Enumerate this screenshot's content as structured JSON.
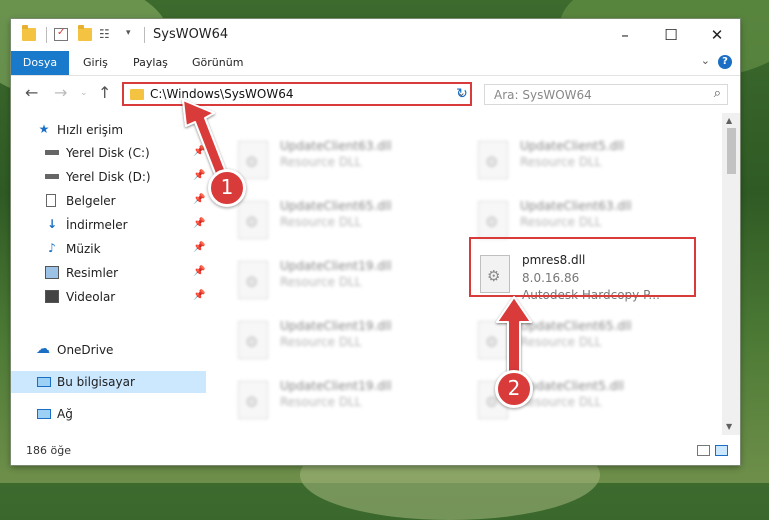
{
  "window": {
    "title": "SysWOW64"
  },
  "ribbon": {
    "tabs": [
      "Dosya",
      "Giriş",
      "Paylaş",
      "Görünüm"
    ]
  },
  "address": {
    "path": "C:\\Windows\\SysWOW64",
    "search_placeholder": "Ara: SysWOW64"
  },
  "sidebar": {
    "items": [
      {
        "label": "Hızlı erişim",
        "icon": "star-icon"
      },
      {
        "label": "Yerel Disk (C:)",
        "icon": "drive-icon"
      },
      {
        "label": "Yerel Disk (D:)",
        "icon": "drive-icon"
      },
      {
        "label": "Belgeler",
        "icon": "document-icon"
      },
      {
        "label": "İndirmeler",
        "icon": "download-icon"
      },
      {
        "label": "Müzik",
        "icon": "music-icon"
      },
      {
        "label": "Resimler",
        "icon": "picture-icon"
      },
      {
        "label": "Videolar",
        "icon": "video-icon"
      },
      {
        "label": "OneDrive",
        "icon": "cloud-icon"
      },
      {
        "label": "Bu bilgisayar",
        "icon": "computer-icon"
      },
      {
        "label": "Ağ",
        "icon": "network-icon"
      }
    ]
  },
  "files": {
    "r1c1": {
      "name": "UpdateClient63.dll",
      "desc": "Resource DLL"
    },
    "r1c2": {
      "name": "UpdateClient5.dll",
      "desc": "Resource DLL"
    },
    "r2c1": {
      "name": "UpdateClient65.dll",
      "desc": "Resource DLL"
    },
    "r2c2": {
      "name": "UpdateClient63.dll",
      "desc": "Resource DLL"
    },
    "r3c1": {
      "name": "UpdateClient19.dll",
      "desc": "Resource DLL"
    },
    "r4c1": {
      "name": "UpdateClient19.dll",
      "desc": "Resource DLL"
    },
    "r4c2": {
      "name": "UpdateClient65.dll",
      "desc": "Resource DLL"
    },
    "r5c1": {
      "name": "UpdateClient19.dll",
      "desc": "Resource DLL"
    },
    "r5c2": {
      "name": "UpdateClient5.dll",
      "desc": "Resource DLL"
    },
    "target": {
      "name": "pmres8.dll",
      "version": "8.0.16.86",
      "desc": "Autodesk Hardcopy P..."
    }
  },
  "status": {
    "count": "186 öğe"
  },
  "annotations": {
    "step1": "1",
    "step2": "2"
  },
  "colors": {
    "accent": "#1979ca",
    "highlight": "#d93a3a"
  }
}
